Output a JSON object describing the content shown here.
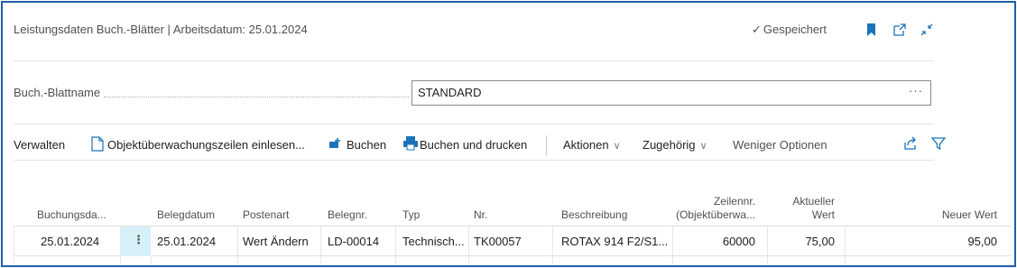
{
  "header": {
    "title": "Leistungsdaten Buch.-Blätter | Arbeitsdatum: 25.01.2024",
    "saved_label": "Gespeichert",
    "icons": [
      "bookmark-icon",
      "open-new-window-icon",
      "collapse-icon"
    ]
  },
  "field": {
    "label": "Buch.-Blattname",
    "value": "STANDARD",
    "more": "···"
  },
  "actions": {
    "manage": "Verwalten",
    "read_lines": "Objektüberwachungszeilen einlesen...",
    "post": "Buchen",
    "post_print": "Buchen und drucken",
    "actions_menu": "Aktionen",
    "related_menu": "Zugehörig",
    "fewer_options": "Weniger Optionen"
  },
  "grid": {
    "columns": {
      "posting_date": "Buchungsda...",
      "document_date": "Belegdatum",
      "entry_type": "Postenart",
      "document_no": "Belegnr.",
      "type": "Typ",
      "no": "Nr.",
      "description": "Beschreibung",
      "line_no_1": "Zeilennr.",
      "line_no_2": "(Objektüberwa...",
      "current_value_1": "Aktueller",
      "current_value_2": "Wert",
      "new_value": "Neuer Wert"
    },
    "rows": [
      {
        "posting_date": "25.01.2024",
        "document_date": "25.01.2024",
        "entry_type": "Wert Ändern",
        "document_no": "LD-00014",
        "type": "Technisch...",
        "no": "TK00057",
        "description": "ROTAX 914 F2/S1...",
        "line_no": "60000",
        "current_value": "75,00",
        "new_value": "95,00"
      }
    ]
  },
  "colors": {
    "frame": "#1f5fa6",
    "accent": "#1a73b8",
    "selected_cell": "#d7f0f7"
  }
}
